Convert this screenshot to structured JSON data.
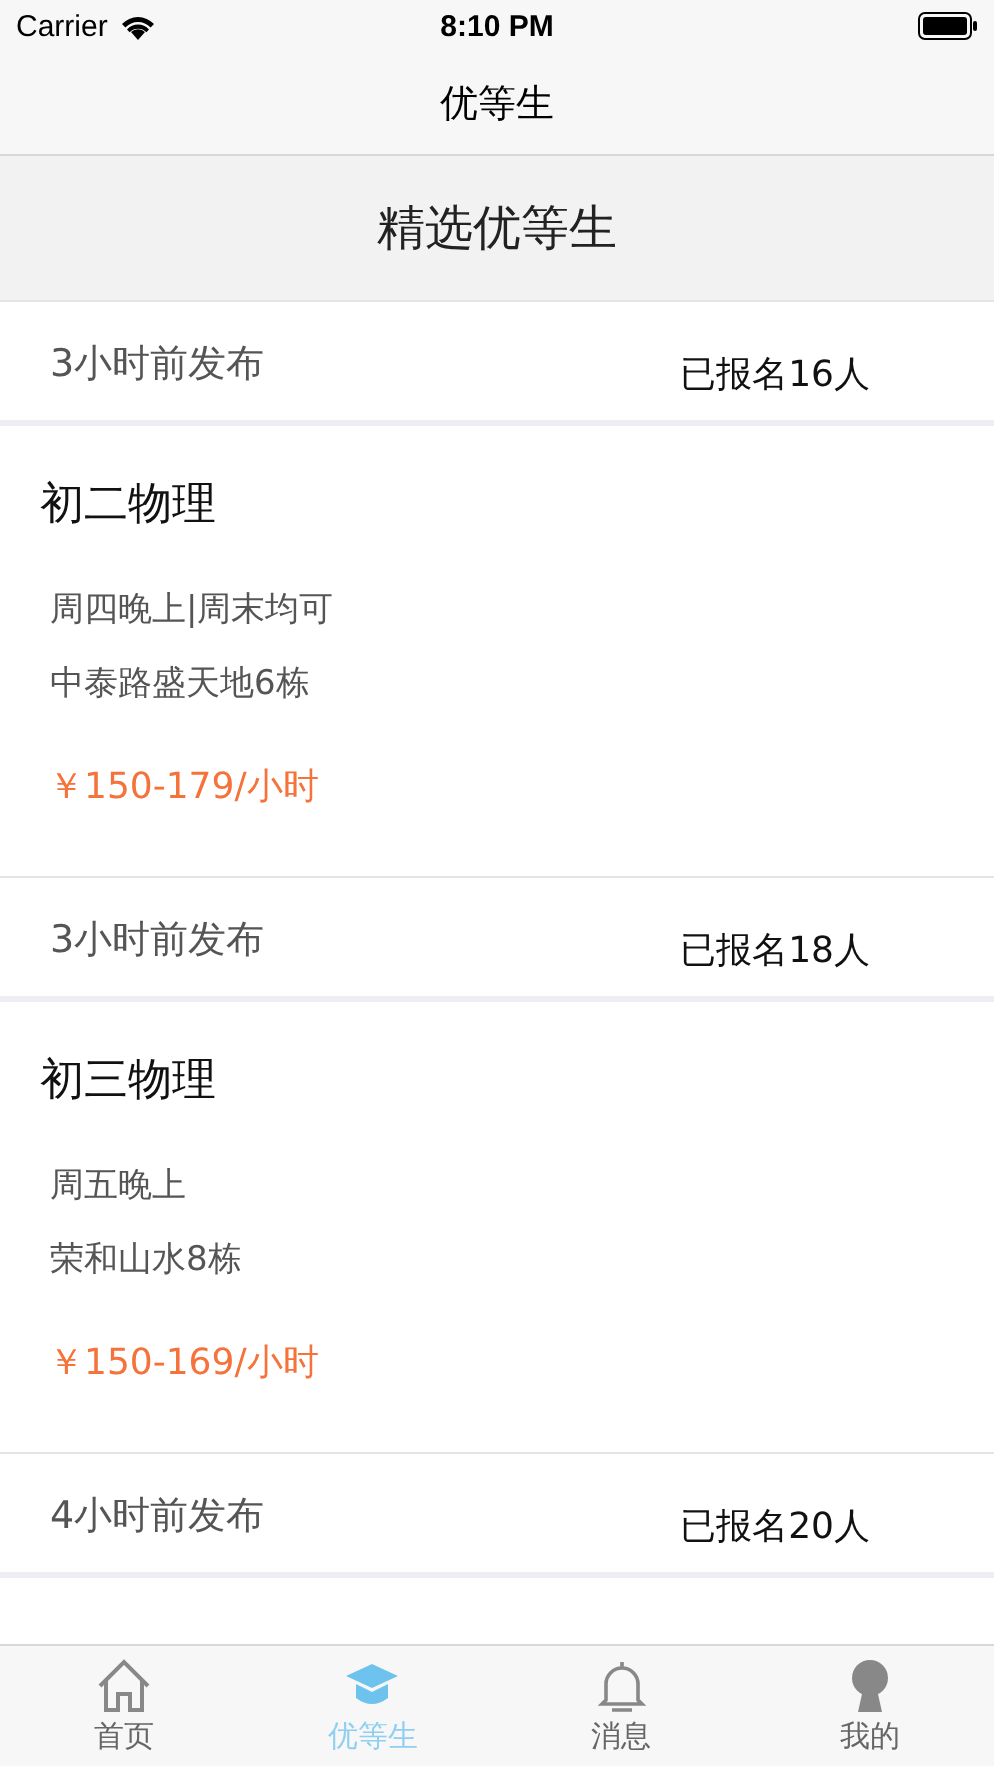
{
  "status_bar": {
    "carrier": "Carrier",
    "time": "8:10 PM"
  },
  "nav": {
    "title": "优等生"
  },
  "section_header": "精选优等生",
  "posts": [
    {
      "posted": "3小时前发布",
      "signed_up": "已报名16人",
      "title": "初二物理",
      "schedule": "周四晚上|周末均可",
      "address": "中泰路盛天地6栋",
      "price": "￥150-179/小时"
    },
    {
      "posted": "3小时前发布",
      "signed_up": "已报名18人",
      "title": "初三物理",
      "schedule": "周五晚上",
      "address": "荣和山水8栋",
      "price": "￥150-169/小时"
    },
    {
      "posted": "4小时前发布",
      "signed_up": "已报名20人"
    }
  ],
  "tabs": [
    {
      "label": "首页",
      "kind": "home",
      "selected": false
    },
    {
      "label": "优等生",
      "kind": "student",
      "selected": true
    },
    {
      "label": "消息",
      "kind": "bell",
      "selected": false
    },
    {
      "label": "我的",
      "kind": "profile",
      "selected": false
    }
  ]
}
